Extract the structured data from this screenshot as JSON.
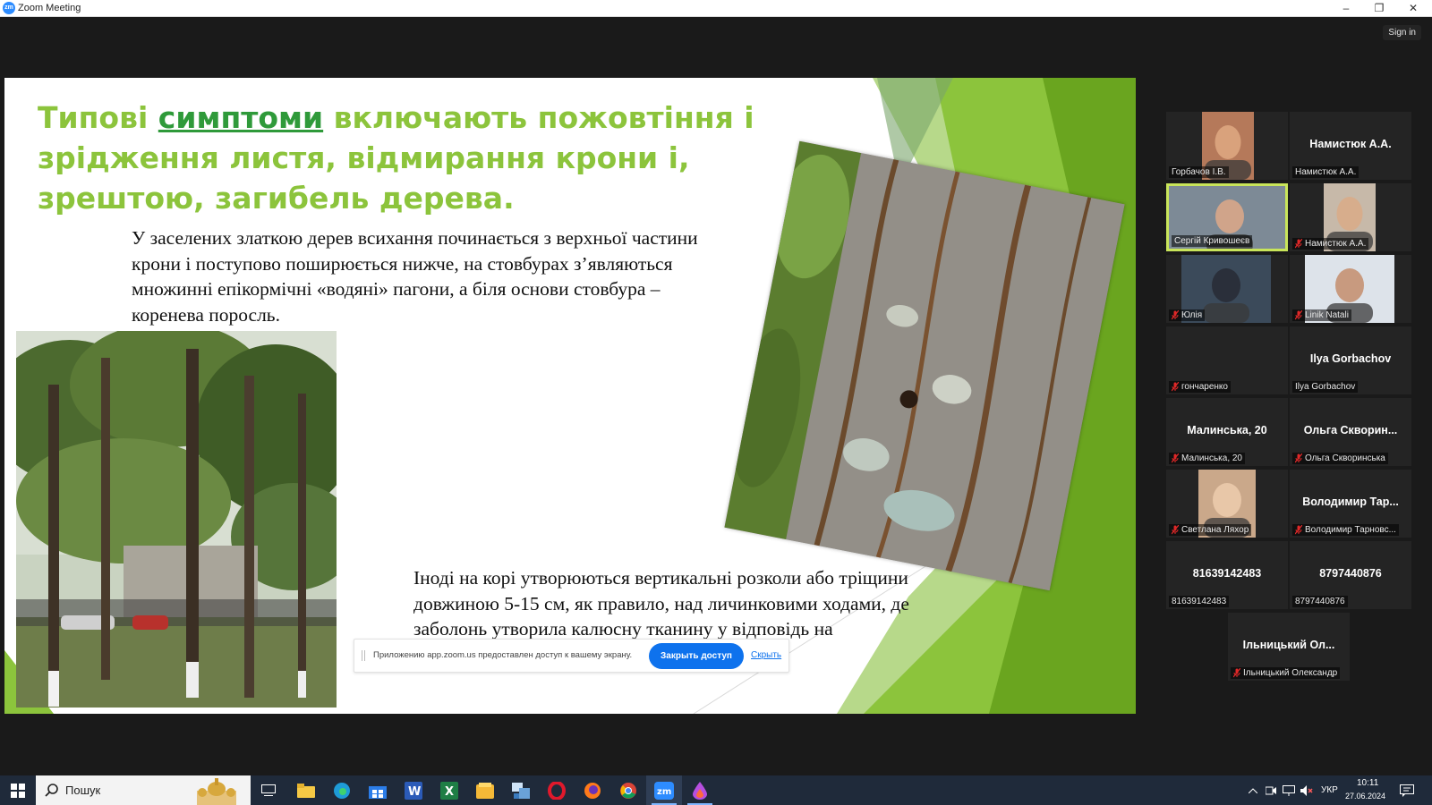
{
  "window": {
    "title": "Zoom Meeting",
    "logo_text": "zm",
    "controls": {
      "minimize": "–",
      "restore": "❐",
      "close": "✕"
    }
  },
  "header": {
    "sign_in": "Sign in"
  },
  "slide": {
    "title_pre": "Типові ",
    "title_link": "симптоми",
    "title_post": " включають пожовтіння і зрідження листя, відмирання крони і, зрештою, загибель дерева.",
    "paragraph1": "У заселених златкою дерев всихання починається з верхньої частини крони і поступово поширюється нижче, на стовбурах з’являються множинні епікормічні «водяні» пагони, а біля основи стовбура – коренева поросль.",
    "paragraph2": "Іноді на корі утворюються вертикальні розколи або тріщини довжиною 5-15 см, як правило, над личинковими ходами, де заболонь утворила калюсну тканину у відповідь на",
    "colors": {
      "title": "#8cc43c",
      "link": "#2f9a3a",
      "accent_green": "#7ab52c"
    }
  },
  "share_banner": {
    "message": "Приложению app.zoom.us предоставлен доступ к вашему экрану.",
    "stop_button": "Закрыть доступ",
    "hide_link": "Скрыть"
  },
  "participants": [
    {
      "label": "Горбачов І.В.",
      "big_name": "",
      "video": true,
      "muted": false
    },
    {
      "label": "Намистюк А.А.",
      "big_name": "Намистюк А.А.",
      "video": false,
      "muted": false
    },
    {
      "label": "Сергій Кривошеєв",
      "big_name": "",
      "video": true,
      "muted": false,
      "active": true
    },
    {
      "label": "Намистюк А.А.",
      "big_name": "",
      "video": true,
      "muted": true
    },
    {
      "label": "Юлія",
      "big_name": "",
      "video": true,
      "muted": true
    },
    {
      "label": "Linik Natali",
      "big_name": "",
      "video": true,
      "muted": true
    },
    {
      "label": "гончаренко",
      "big_name": "",
      "video": false,
      "muted": true
    },
    {
      "label": "Ilya Gorbachov",
      "big_name": "Ilya Gorbachov",
      "video": false,
      "muted": false
    },
    {
      "label": "Малинська, 20",
      "big_name": "Малинська, 20",
      "video": false,
      "muted": true
    },
    {
      "label": "Ольга Скворинська",
      "big_name": "Ольга Скворин...",
      "video": false,
      "muted": true
    },
    {
      "label": "Светлана Ляхор",
      "big_name": "",
      "video": true,
      "muted": true
    },
    {
      "label": "Володимир Тарновс...",
      "big_name": "Володимир Тар...",
      "video": false,
      "muted": true
    },
    {
      "label": "81639142483",
      "big_name": "81639142483",
      "video": false,
      "muted": false
    },
    {
      "label": "8797440876",
      "big_name": "8797440876",
      "video": false,
      "muted": false
    },
    {
      "label": "Ільницький Олександр",
      "big_name": "Ільницький Ол...",
      "video": false,
      "muted": true
    }
  ],
  "taskbar": {
    "search_placeholder": "Пошук",
    "apps": [
      "windows-start",
      "task-view",
      "file-explorer",
      "edge",
      "store",
      "word",
      "excel",
      "notes",
      "file-manager",
      "opera",
      "firefox",
      "chrome",
      "zoom",
      "drop-app"
    ],
    "language": "УКР",
    "time": "10:11",
    "date": "27.06.2024"
  }
}
